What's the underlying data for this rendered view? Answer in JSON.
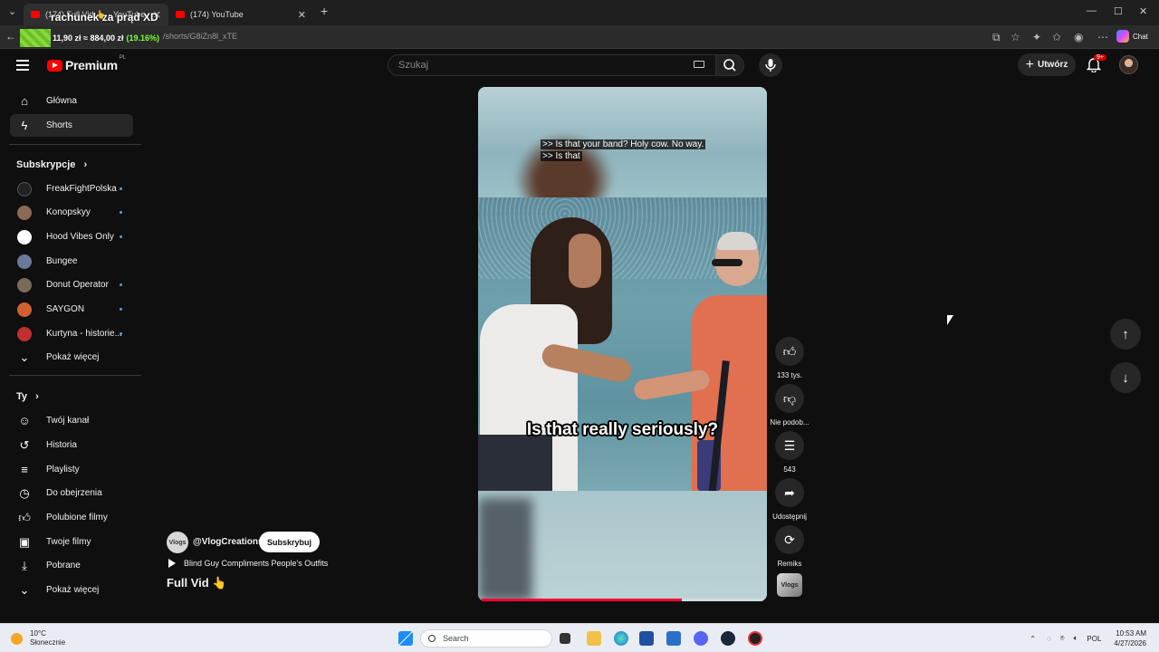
{
  "browser": {
    "tabs": [
      {
        "label": "(174) Full Vid 👆 - YouTube",
        "active": true
      },
      {
        "label": "(174) YouTube",
        "active": false
      }
    ],
    "url": "/shorts/G8iZn8l_xTE"
  },
  "overlay": {
    "title": "rachunek za prąd XD",
    "ticker_value": "11,90 zł ≈ 884,00 zł",
    "ticker_percent": "(19.16%)"
  },
  "header": {
    "logo_text": "Premium",
    "logo_region": "PL",
    "search_placeholder": "Szukaj",
    "create_label": "Utwórz",
    "notifications_badge": "9+",
    "extension_label": "Chat"
  },
  "sidebar": {
    "main": [
      {
        "label": "Główna",
        "icon": "home-icon"
      },
      {
        "label": "Shorts",
        "icon": "shorts-icon",
        "active": true
      }
    ],
    "subscriptions_heading": "Subskrypcje",
    "subscriptions": [
      {
        "label": "FreakFightPolska",
        "color": "#222222"
      },
      {
        "label": "Konopskyy",
        "color": "#8a6a55"
      },
      {
        "label": "Hood Vibes Only",
        "color": "#ffffff"
      },
      {
        "label": "Bungee",
        "color": "#6a7a9a"
      },
      {
        "label": "Donut Operator",
        "color": "#7a6a5a"
      },
      {
        "label": "SAYGON",
        "color": "#d06030"
      },
      {
        "label": "Kurtyna - historie...",
        "color": "#c03030"
      }
    ],
    "show_more_subs": "Pokaż więcej",
    "you_heading": "Ty",
    "you": [
      {
        "label": "Twój kanał",
        "icon": "channel-icon"
      },
      {
        "label": "Historia",
        "icon": "history-icon"
      },
      {
        "label": "Playlisty",
        "icon": "playlist-icon"
      },
      {
        "label": "Do obejrzenia",
        "icon": "watch-later-icon"
      },
      {
        "label": "Polubione filmy",
        "icon": "like-icon"
      },
      {
        "label": "Twoje filmy",
        "icon": "your-videos-icon"
      },
      {
        "label": "Pobrane",
        "icon": "download-icon"
      }
    ],
    "show_more_you": "Pokaż więcej"
  },
  "video": {
    "caption_line1": ">> Is that your band? Holy cow. No way.",
    "caption_line2": ">> Is that",
    "burned_caption": "Is that really seriously?",
    "progress": 0.71
  },
  "actions": {
    "likes": "133 tys.",
    "dislike": "Nie podob...",
    "comments": "543",
    "share": "Udostępnij",
    "remix": "Remiks",
    "remix_thumb": "Vlogs"
  },
  "channel": {
    "avatar_text": "Vlogs",
    "name": "@VlogCreations",
    "subscribe_label": "Subskrybuj",
    "linked_video": "Blind Guy Compliments People's Outfits",
    "title": "Full Vid 👆"
  },
  "taskbar": {
    "temperature": "10°C",
    "weather": "Słonecznie",
    "search_label": "Search",
    "language": "POL",
    "time": "10:53 AM",
    "date": "4/27/2026"
  }
}
